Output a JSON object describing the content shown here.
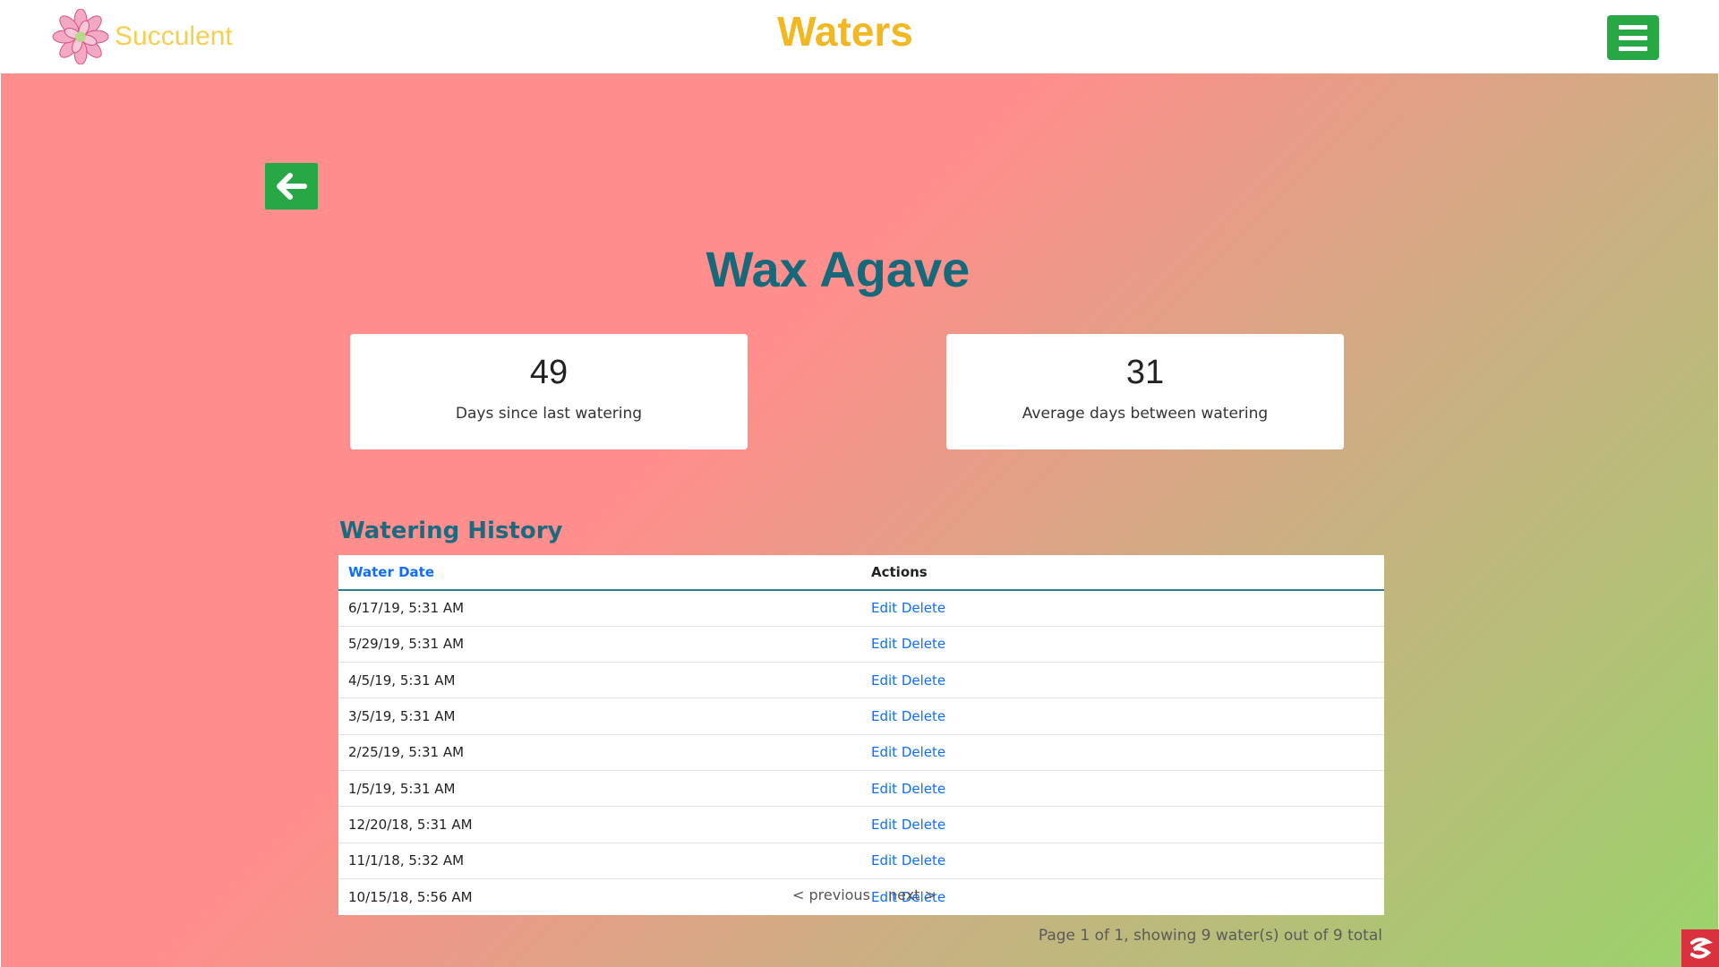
{
  "header": {
    "brand_name": "Succulent",
    "page_title": "Waters",
    "menu_icon": "hamburger-menu-icon"
  },
  "navigation": {
    "back_icon": "arrow-left-icon"
  },
  "plant": {
    "name": "Wax Agave"
  },
  "stats": [
    {
      "value": "49",
      "label": "Days since last watering"
    },
    {
      "value": "31",
      "label": "Average days between watering"
    }
  ],
  "history": {
    "heading": "Watering History",
    "columns": {
      "date": "Water Date",
      "actions": "Actions"
    },
    "edit_label": "Edit",
    "delete_label": "Delete",
    "rows": [
      "6/17/19, 5:31 AM",
      "5/29/19, 5:31 AM",
      "4/5/19, 5:31 AM",
      "3/5/19, 5:31 AM",
      "2/25/19, 5:31 AM",
      "1/5/19, 5:31 AM",
      "12/20/18, 5:31 AM",
      "11/1/18, 5:32 AM",
      "10/15/18, 5:56 AM"
    ]
  },
  "pagination": {
    "previous_label": "< previous",
    "next_label": "next >",
    "summary": "Page 1 of 1, showing 9 water(s) out of 9 total"
  },
  "colors": {
    "brand_gold": "#f2b824",
    "action_green": "#28a745",
    "title_teal": "#17697a",
    "link_blue": "#0d6efd",
    "gradient_start": "#ff8e8c",
    "gradient_end": "#9ad36a"
  }
}
